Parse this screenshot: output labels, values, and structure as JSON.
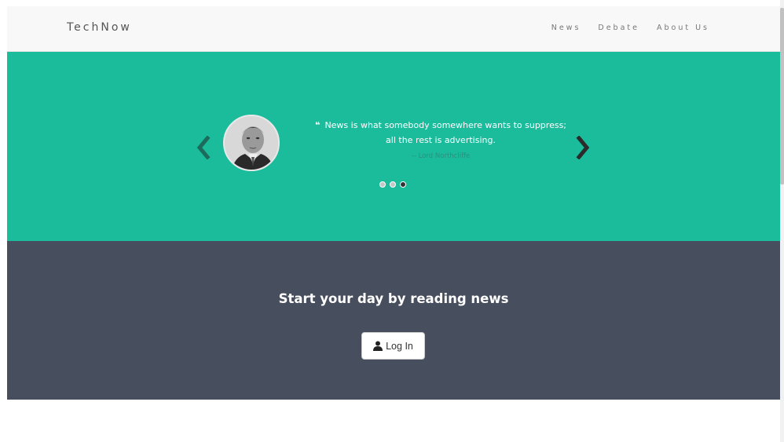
{
  "navbar": {
    "brand": "TechNow",
    "links": [
      "News",
      "Debate",
      "About Us"
    ]
  },
  "hero": {
    "background_color": "#1abc9c",
    "quote_icon": "quote-left-icon",
    "quote_line1": "News is what somebody somewhere wants to suppress;",
    "quote_line2": "all the rest is advertising.",
    "author": "-- Lord Northcliffe",
    "slides_count": 3,
    "active_slide": 3,
    "prev_icon": "chevron-left-icon",
    "next_icon": "chevron-right-icon"
  },
  "cta": {
    "background_color": "#474e5d",
    "title": "Start your day by reading news",
    "login_label": "Log In",
    "login_icon": "user-icon"
  }
}
